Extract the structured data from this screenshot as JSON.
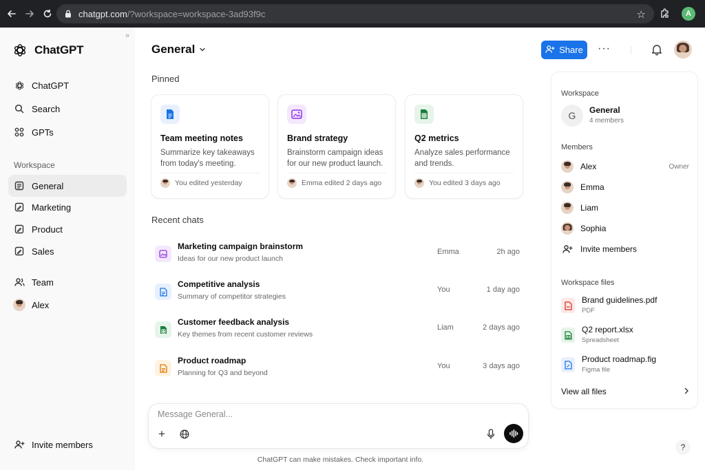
{
  "browser": {
    "url_host": "chatgpt.com",
    "url_rest": "/?workspace=workspace-3ad93f9c",
    "profile_initial": "A"
  },
  "sidebar": {
    "brand": "ChatGPT",
    "nav": [
      {
        "label": "ChatGPT",
        "icon": "openai-icon"
      },
      {
        "label": "Search",
        "icon": "search-icon"
      },
      {
        "label": "GPTs",
        "icon": "grid-icon"
      }
    ],
    "workspace_label": "Workspace",
    "workspace_items": [
      {
        "label": "General",
        "icon": "document-icon",
        "active": true
      },
      {
        "label": "Marketing",
        "icon": "edit-document-icon"
      },
      {
        "label": "Product",
        "icon": "edit-document-icon"
      },
      {
        "label": "Sales",
        "icon": "edit-document-icon"
      }
    ],
    "team_label": "Team",
    "user_label": "Alex",
    "invite_label": "Invite members"
  },
  "header": {
    "title": "General",
    "share_label": "Share",
    "more_label": "···"
  },
  "pinned": {
    "heading": "Pinned",
    "cards": [
      {
        "title": "Team meeting notes",
        "desc": "Summarize key takeaways from today's meeting.",
        "meta": "You edited yesterday",
        "icon": "document-icon",
        "color": "#1a73e8",
        "bg": "#e8f0fe"
      },
      {
        "title": "Brand strategy",
        "desc": "Brainstorm campaign ideas for our new product launch.",
        "meta": "Emma edited 2 days ago",
        "icon": "image-icon",
        "color": "#9334e6",
        "bg": "#f3e8fd"
      },
      {
        "title": "Q2 metrics",
        "desc": "Analyze sales performance and trends.",
        "meta": "You edited 3 days ago",
        "icon": "spreadsheet-icon",
        "color": "#188038",
        "bg": "#e6f4ea"
      }
    ]
  },
  "recent": {
    "heading": "Recent chats",
    "rows": [
      {
        "title": "Marketing campaign brainstorm",
        "sub": "Ideas for our new product launch",
        "who": "Emma",
        "time": "2h ago",
        "icon": "image-icon",
        "color": "#9334e6",
        "bg": "#f3e8fd"
      },
      {
        "title": "Competitive analysis",
        "sub": "Summary of competitor strategies",
        "who": "You",
        "time": "1 day ago",
        "icon": "document-icon",
        "color": "#1a73e8",
        "bg": "#e8f0fe"
      },
      {
        "title": "Customer feedback analysis",
        "sub": "Key themes from recent customer reviews",
        "who": "Liam",
        "time": "2 days ago",
        "icon": "spreadsheet-icon",
        "color": "#188038",
        "bg": "#e6f4ea"
      },
      {
        "title": "Product roadmap",
        "sub": "Planning for Q3 and beyond",
        "who": "You",
        "time": "3 days ago",
        "icon": "document-icon",
        "color": "#e37400",
        "bg": "#fef3e2"
      }
    ]
  },
  "composer": {
    "placeholder": "Message General...",
    "disclaimer": "ChatGPT can make mistakes. Check important info."
  },
  "panel": {
    "workspace_label": "Workspace",
    "workspace_initial": "G",
    "workspace_name": "General",
    "workspace_members": "4 members",
    "members_label": "Members",
    "members": [
      {
        "name": "Alex",
        "role": "Owner"
      },
      {
        "name": "Emma",
        "role": ""
      },
      {
        "name": "Liam",
        "role": ""
      },
      {
        "name": "Sophia",
        "role": ""
      }
    ],
    "invite_label": "Invite members",
    "files_label": "Workspace files",
    "files": [
      {
        "name": "Brand guidelines.pdf",
        "type": "PDF",
        "icon": "pdf-icon",
        "color": "#d93025",
        "bg": "#fce8e6"
      },
      {
        "name": "Q2 report.xlsx",
        "type": "Spreadsheet",
        "icon": "spreadsheet-icon",
        "color": "#188038",
        "bg": "#e6f4ea"
      },
      {
        "name": "Product roadmap.fig",
        "type": "Figma file",
        "icon": "figma-icon",
        "color": "#1a73e8",
        "bg": "#e8f0fe"
      }
    ],
    "view_all": "View all files"
  },
  "help_label": "?"
}
